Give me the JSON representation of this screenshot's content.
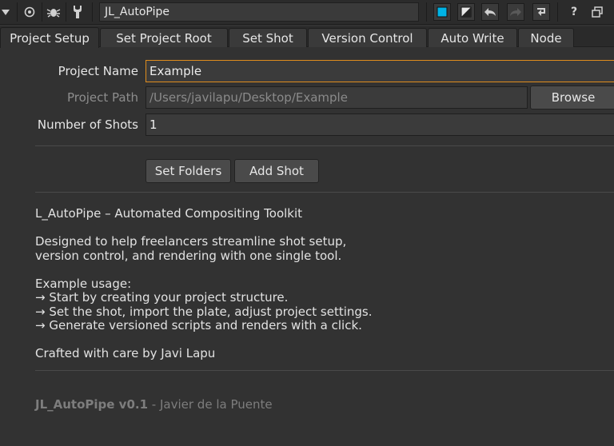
{
  "toolbar": {
    "node_name": "JL_AutoPipe",
    "icons": [
      "collapse-triangle-icon",
      "circle-target-icon",
      "bug-icon",
      "wrench-icon",
      "color-square-icon",
      "color-diagonal-icon",
      "undo-icon",
      "redo-icon",
      "revert-icon",
      "help-icon",
      "float-panel-icon"
    ],
    "help_label": "?",
    "accent_color": "#00b4e6"
  },
  "tabs": [
    {
      "label": "Project Setup",
      "active": true
    },
    {
      "label": "Set Project Root",
      "active": false
    },
    {
      "label": "Set Shot",
      "active": false
    },
    {
      "label": "Version Control",
      "active": false
    },
    {
      "label": "Auto Write",
      "active": false
    },
    {
      "label": "Node",
      "active": false
    }
  ],
  "form": {
    "project_name_label": "Project Name",
    "project_name_value": "Example",
    "project_path_label": "Project Path",
    "project_path_value": "/Users/javilapu/Desktop/Example",
    "browse_label": "Browse",
    "num_shots_label": "Number of Shots",
    "num_shots_value": "1",
    "set_folders_label": "Set Folders",
    "add_shot_label": "Add Shot"
  },
  "info": {
    "title": "L_AutoPipe – Automated Compositing Toolkit",
    "desc_line1": "Designed to help freelancers streamline shot setup,",
    "desc_line2": "version control, and rendering with one single tool.",
    "usage_title": "Example usage:",
    "usage_1": "→ Start by creating your project structure.",
    "usage_2": "→ Set the shot, import the plate, adjust project settings.",
    "usage_3": "→ Generate versioned scripts and renders with a click.",
    "credit": "Crafted with care by Javi Lapu"
  },
  "footer": {
    "product": "JL_AutoPipe v0.1",
    "separator": " - ",
    "author": "Javier de la Puente"
  },
  "colors": {
    "focus_border": "#e08d1d",
    "panel_bg": "#323232"
  }
}
